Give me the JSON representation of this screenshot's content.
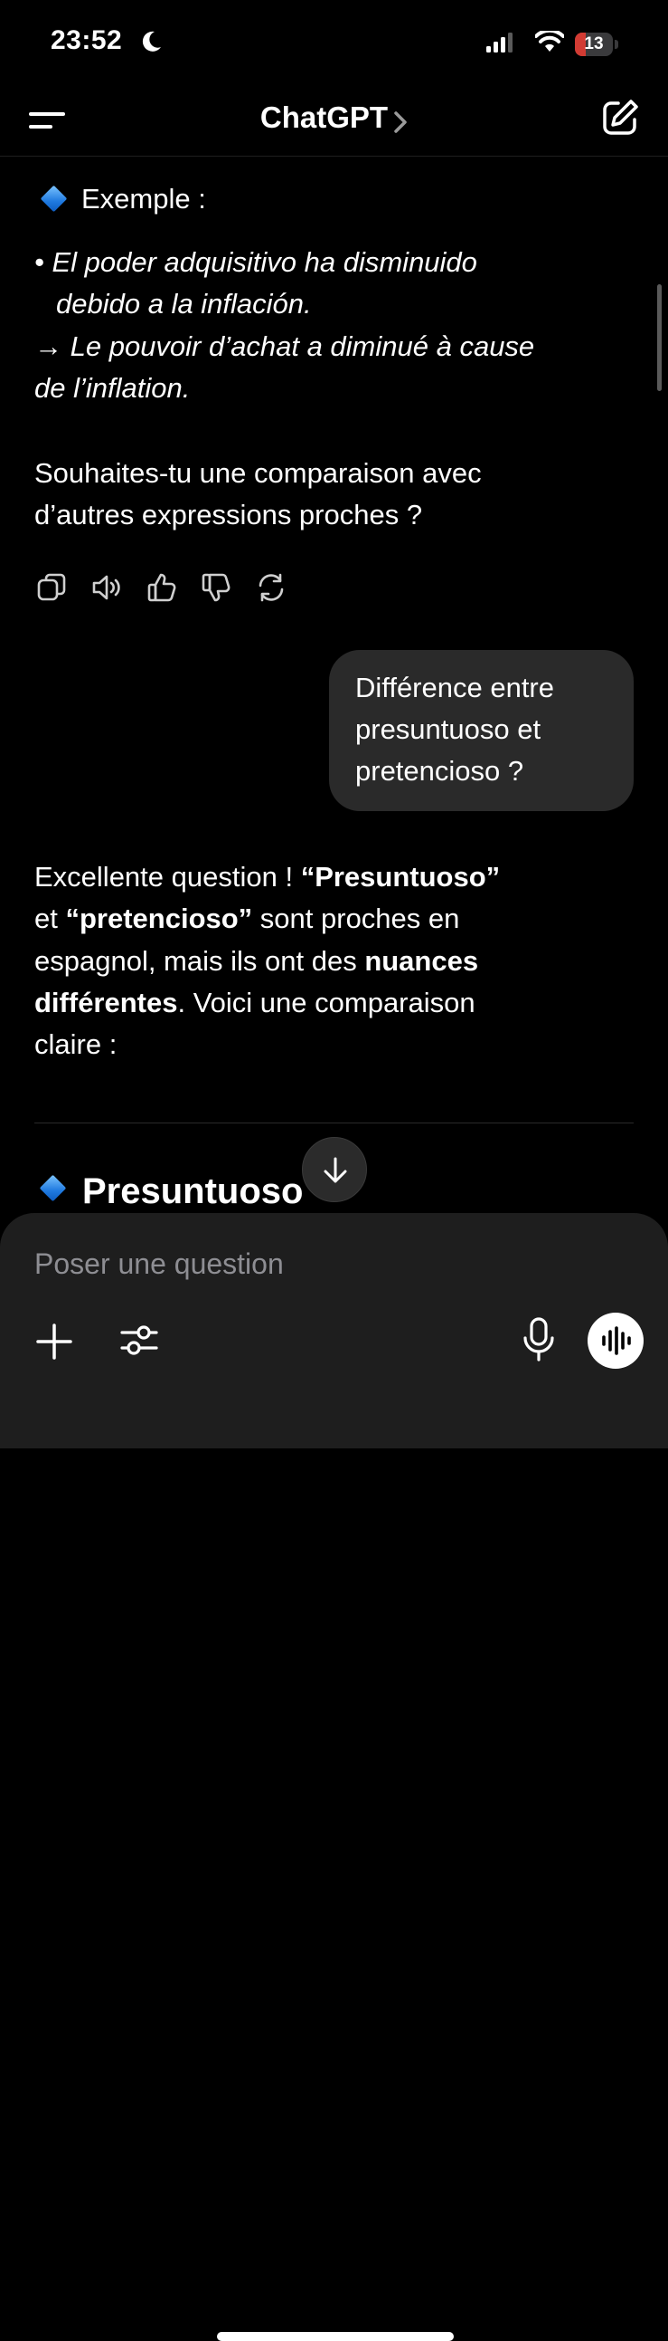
{
  "status_bar": {
    "time": "23:52",
    "battery_level": "13",
    "battery_fraction": 0.13,
    "battery_color": "#d23b33",
    "icons": [
      "moon-icon",
      "cellular-signal-icon",
      "wifi-icon",
      "battery-icon"
    ]
  },
  "header": {
    "title": "ChatGPT",
    "icons": [
      "sidebar-menu-icon",
      "chevron-right-icon",
      "new-chat-icon"
    ]
  },
  "chat": {
    "example_heading": "Exemple :",
    "example_lines": [
      "• El poder adquisitivo ha disminuido",
      "debido a la inflación.",
      "→ Le pouvoir d’achat a diminué à cause",
      "de l’inflation."
    ],
    "question_lines": [
      "Souhaites-tu une comparaison avec",
      "d’autres expressions proches ?"
    ],
    "action_icons": [
      "copy-icon",
      "read-aloud-icon",
      "thumbs-up-icon",
      "thumbs-down-icon",
      "regenerate-icon"
    ],
    "user_message_lines": [
      "Différence entre",
      "presuntuoso et",
      "pretencioso ?"
    ],
    "answer": {
      "line1_plain": "Excellente question ! ",
      "line1_bold": "“Presuntuoso”",
      "line2_plain_start": "et ",
      "line2_bold": "“pretencioso”",
      "line2_plain_end": " sont proches en",
      "line3_plain": "espagnol, mais ils ont des ",
      "line3_bold": "nuances",
      "line4_bold": "différentes",
      "line4_plain": ". Voici une comparaison",
      "line5_plain": "claire :"
    },
    "section_heading": "Presuntuoso"
  },
  "composer": {
    "placeholder": "Poser une question",
    "icons": [
      "plus-icon",
      "tools-sliders-icon",
      "microphone-icon",
      "voice-mode-icon"
    ]
  },
  "colors": {
    "background": "#000000",
    "bubble": "#2a2a2a",
    "composer": "#1e1e1e",
    "placeholder": "#8e8e93",
    "diamond": "#1f7ae0"
  }
}
